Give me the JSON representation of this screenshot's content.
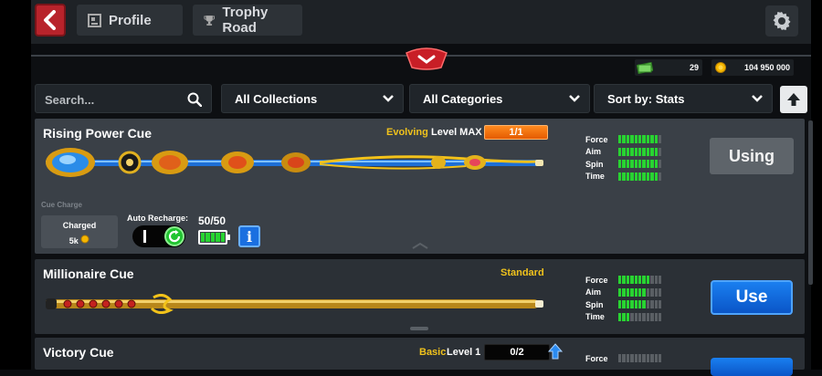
{
  "header": {
    "profile_label": "Profile",
    "trophy_label": "Trophy Road"
  },
  "currency": {
    "cash": "29",
    "coins": "104 950 000"
  },
  "filters": {
    "search_placeholder": "Search...",
    "collections": "All Collections",
    "categories": "All Categories",
    "sort": "Sort by: Stats"
  },
  "stat_labels": [
    "Force",
    "Aim",
    "Spin",
    "Time"
  ],
  "cues": [
    {
      "name": "Rising Power Cue",
      "rarity": "Evolving",
      "level": "Level MAX",
      "progress": "1/1",
      "button": "Using",
      "stats": {
        "Force": 10,
        "Aim": 10,
        "Spin": 10,
        "Time": 10
      },
      "charge_label": "Cue Charge",
      "charged_title": "Charged",
      "charged_amount": "5k",
      "auto_recharge_label": "Auto Recharge:",
      "battery_label": "50/50",
      "info_label": "i"
    },
    {
      "name": "Millionaire Cue",
      "rarity": "Standard",
      "button": "Use",
      "stats": {
        "Force": 8,
        "Aim": 7,
        "Spin": 7,
        "Time": 3
      }
    },
    {
      "name": "Victory Cue",
      "rarity": "Basic",
      "level": "Level 1",
      "progress": "0/2",
      "stats": {
        "Force": 0
      }
    }
  ],
  "colors": {
    "accent_red": "#b8232b",
    "stat_green": "#28d431",
    "rarity_gold": "#f0c21c",
    "progress_orange": "#ff8a1f",
    "use_blue": "#1a7ff0"
  }
}
